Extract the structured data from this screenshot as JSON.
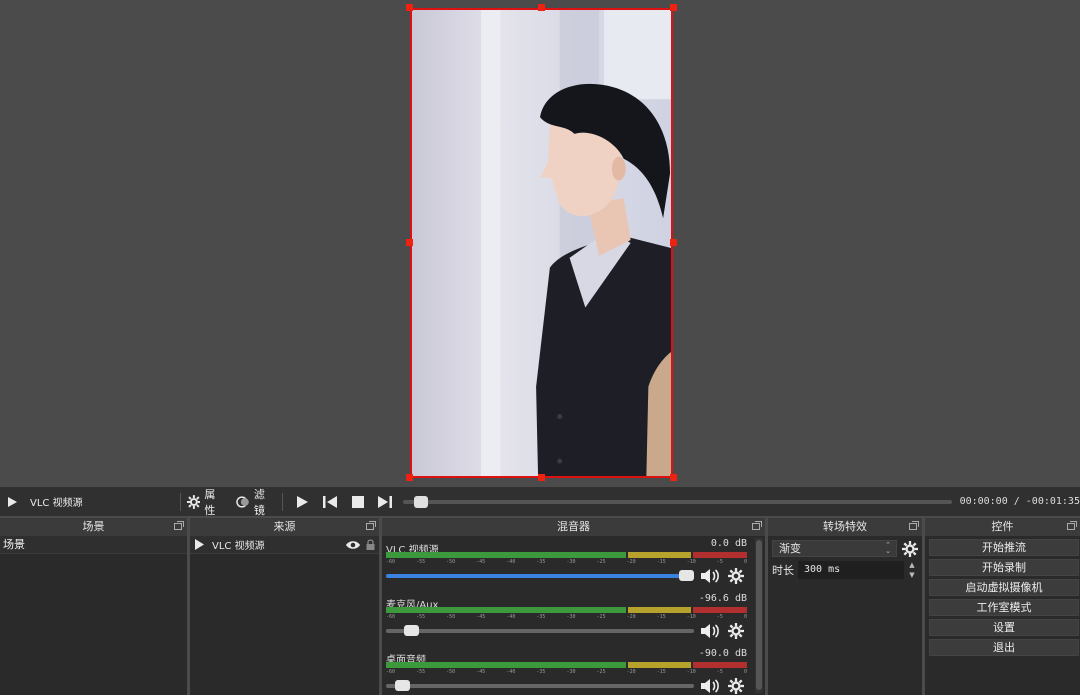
{
  "media_bar": {
    "source_name": "VLC 视频源",
    "properties_label": "属性",
    "filters_label": "滤镜",
    "time": "00:00:00 / -00:01:35",
    "progress": 0.02
  },
  "scenes": {
    "title": "场景",
    "items": [
      "场景"
    ]
  },
  "sources": {
    "title": "来源",
    "items": [
      {
        "label": "VLC 视频源",
        "visible": true,
        "locked": true
      }
    ]
  },
  "mixer": {
    "title": "混音器",
    "channels": [
      {
        "name": "VLC 视频源",
        "db": "0.0 dB",
        "volume": 1.0,
        "active": true
      },
      {
        "name": "麦克风/Aux",
        "db": "-96.6 dB",
        "volume": 0.06,
        "active": false
      },
      {
        "name": "桌面音频",
        "db": "-90.0 dB",
        "volume": 0.03,
        "active": false
      }
    ],
    "ticks": [
      "-60",
      "-55",
      "-50",
      "-45",
      "-40",
      "-35",
      "-30",
      "-25",
      "-20",
      "-15",
      "-10",
      "-5",
      "0"
    ]
  },
  "transitions": {
    "title": "转场特效",
    "selected": "渐变",
    "duration_label": "时长",
    "duration_value": "300 ms"
  },
  "controls": {
    "title": "控件",
    "buttons": [
      "开始推流",
      "开始录制",
      "启动虚拟摄像机",
      "工作室模式",
      "设置",
      "退出"
    ]
  },
  "colors": {
    "selection_border": "#dd1111",
    "meter_green": "#3c9a3c",
    "meter_yellow": "#b7a22c",
    "meter_red": "#b22f2f",
    "fader_blue": "#3b82e0"
  }
}
